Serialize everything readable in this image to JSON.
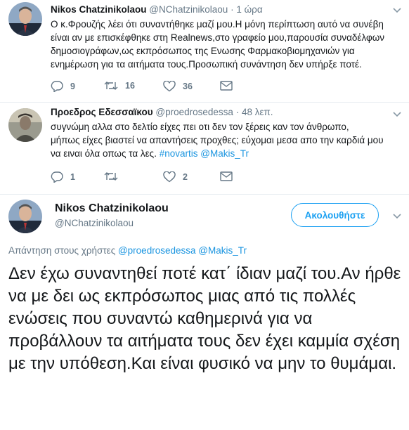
{
  "tweet1": {
    "name": "Nikos Chatzinikolaou",
    "handle": "@NChatzinikolaou",
    "separator": "·",
    "time": "1 ώρα",
    "text": "Ο κ.Φρουζής λέει ότι συναντήθηκε μαζί μου.Η μόνη περίπτωση αυτό να συνέβη είναι αν με επισκέφθηκε στη Realnews,στο γραφείο μου,παρουσία συναδέλφων δημοσιογράφων,ως εκπρόσωπος της Ενωσης Φαρμακοβιομηχανιών για ενημέρωση για τα αιτήματα τους.Προσωπική συνάντηση δεν υπήρξε ποτέ.",
    "replies": "9",
    "retweets": "16",
    "likes": "36"
  },
  "tweet2": {
    "name": "Προεδρος Εδεσσαϊκου",
    "handle": "@proedrosedessa",
    "separator": "·",
    "time": "48 λεπ.",
    "text_line1": "συγνώμη αλλα στο δελτίο είχες πει οτι δεν τον ξέρεις καν τον άνθρωπο,",
    "text_line2": "μήπως είχες βιαστεί να απαντήσεις προχθες; εύχομαι μεσα απο την καρδιά μου",
    "text_line3": "να ειναι όλα οπως τα λες. ",
    "hashtag": "#novartis",
    "mention": "@Makis_Tr",
    "replies": "1",
    "retweets": "",
    "likes": "2"
  },
  "main_tweet": {
    "name": "Nikos Chatzinikolaou",
    "handle": "@NChatzinikolaou",
    "follow_label": "Ακολουθήστε",
    "reply_prefix": "Απάντηση στους χρήστες",
    "reply_user1": "@proedrosedessa",
    "reply_user2": "@Makis_Tr",
    "text": "Δεν έχω συναντηθεί ποτέ κατ΄ ίδιαν μαζί του.Αν ήρθε να με δει ως εκπρόσωπος μιας από τις πολλές ενώσεις που συναντώ καθημερινά για να προβάλλουν τα αιτήματα τους δεν έχει καμμία σχέση με την υπόθεση.Και είναι φυσικό να μην το θυμάμαι."
  },
  "colors": {
    "link": "#1b95e0",
    "follow": "#1da1f2",
    "muted": "#657786"
  },
  "icons": [
    "reply-icon",
    "retweet-icon",
    "like-icon",
    "message-icon",
    "chevron-down-icon"
  ]
}
